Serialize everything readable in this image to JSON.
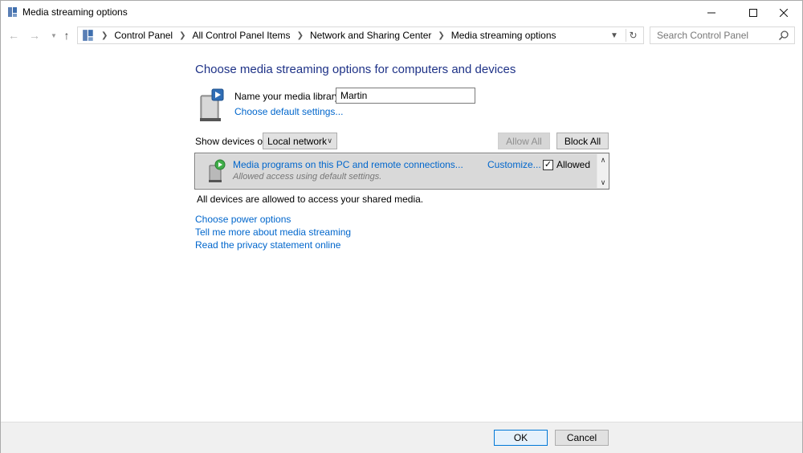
{
  "window": {
    "title": "Media streaming options",
    "icon": "control-panel-icon",
    "controls": {
      "minimize": "minimize-icon",
      "maximize": "maximize-icon",
      "close": "close-icon"
    }
  },
  "nav": {
    "breadcrumbs": [
      "Control Panel",
      "All Control Panel Items",
      "Network and Sharing Center",
      "Media streaming options"
    ],
    "search_placeholder": "Search Control Panel"
  },
  "main": {
    "heading": "Choose media streaming options for computers and devices",
    "library_label": "Name your media library:",
    "library_value": "Martin",
    "default_settings_link": "Choose default settings...",
    "show_devices_label": "Show devices on:",
    "show_devices_value": "Local network",
    "allow_all": "Allow All",
    "block_all": "Block All",
    "device": {
      "title": "Media programs on this PC and remote connections...",
      "subtitle": "Allowed access using default settings.",
      "customize": "Customize...",
      "allowed_label": "Allowed",
      "allowed_checked": true
    },
    "all_devices_text": "All devices are allowed to access your shared media.",
    "links": [
      "Choose power options",
      "Tell me more about media streaming",
      "Read the privacy statement online"
    ]
  },
  "footer": {
    "ok": "OK",
    "cancel": "Cancel"
  },
  "colors": {
    "heading": "#1e3287",
    "link": "#0066cc",
    "footer_bg": "#f0f0f0"
  }
}
